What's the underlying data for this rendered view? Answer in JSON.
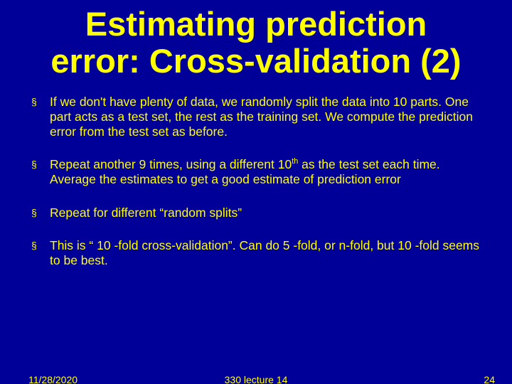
{
  "title_line1": "Estimating prediction",
  "title_line2": "error: Cross-validation (2)",
  "bullets": {
    "b1": "If we don't have plenty of data, we randomly split the data into 10 parts. One part acts as a test set, the rest as the training set. We compute the prediction error from the test set as before.",
    "b2a": "Repeat another 9 times, using a different 10",
    "b2sup": "th",
    "b2b": " as the test set each time. Average the estimates to get a good estimate of prediction error",
    "b3": "Repeat for different “random splits”",
    "b4": "This is “ 10 -fold cross-validation”. Can do 5 -fold, or n-fold, but 10 -fold seems to be best."
  },
  "footer": {
    "date": "11/28/2020",
    "center": "330 lecture 14",
    "page": "24"
  }
}
